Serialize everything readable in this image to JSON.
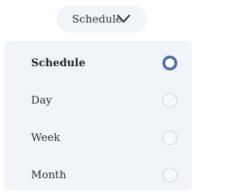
{
  "trigger": {
    "label": "Schedule",
    "chevron_icon": "chevron-down-icon"
  },
  "menu": {
    "options": [
      {
        "label": "Schedule",
        "selected": true
      },
      {
        "label": "Day",
        "selected": false
      },
      {
        "label": "Week",
        "selected": false
      },
      {
        "label": "Month",
        "selected": false
      }
    ]
  },
  "colors": {
    "accent": "#4a6ea6",
    "surface": "#f1f4f9",
    "text": "#2b2f36",
    "radio_border": "#c8ccd3"
  }
}
